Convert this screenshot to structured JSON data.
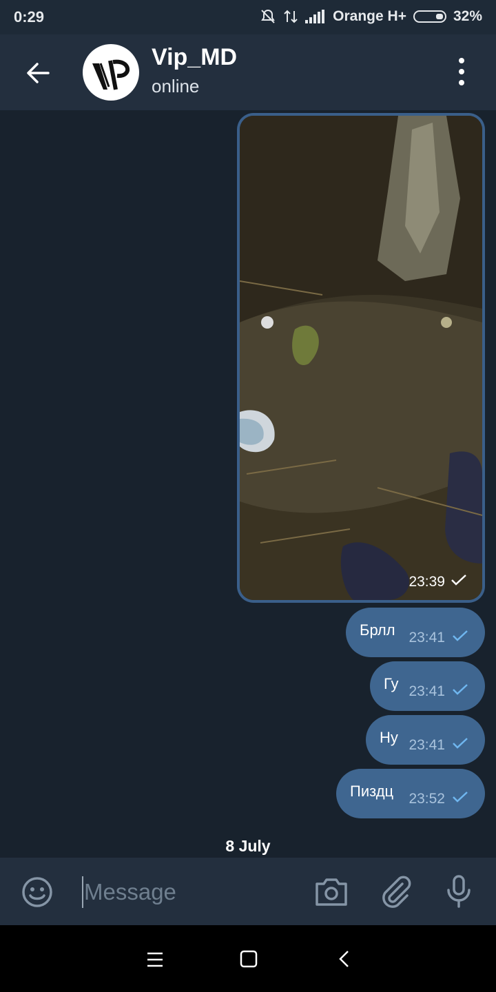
{
  "status_bar": {
    "time": "0:29",
    "carrier": "Orange H+",
    "battery": "32%"
  },
  "header": {
    "contact_name": "Vip_MD",
    "status": "online"
  },
  "messages": [
    {
      "type": "photo",
      "time": "23:39"
    },
    {
      "type": "text",
      "text": "Брлл",
      "time": "23:41"
    },
    {
      "type": "text",
      "text": "Гу",
      "time": "23:41"
    },
    {
      "type": "text",
      "text": "Ну",
      "time": "23:41"
    },
    {
      "type": "text",
      "text": "Пиздц",
      "time": "23:52"
    }
  ],
  "date_separator": "8 July",
  "composer": {
    "placeholder": "Message"
  },
  "colors": {
    "background": "#18222d",
    "header": "#232f3e",
    "outgoing_bubble": "#3f6690",
    "check": "#6fb6ef"
  },
  "icons": [
    "back-arrow-icon",
    "more-vert-icon",
    "mute-bell-icon",
    "data-arrows-icon",
    "signal-icon",
    "battery-icon",
    "check-icon",
    "emoji-icon",
    "camera-icon",
    "attach-icon",
    "mic-icon",
    "menu-lines-icon",
    "home-square-icon",
    "back-chevron-icon"
  ]
}
